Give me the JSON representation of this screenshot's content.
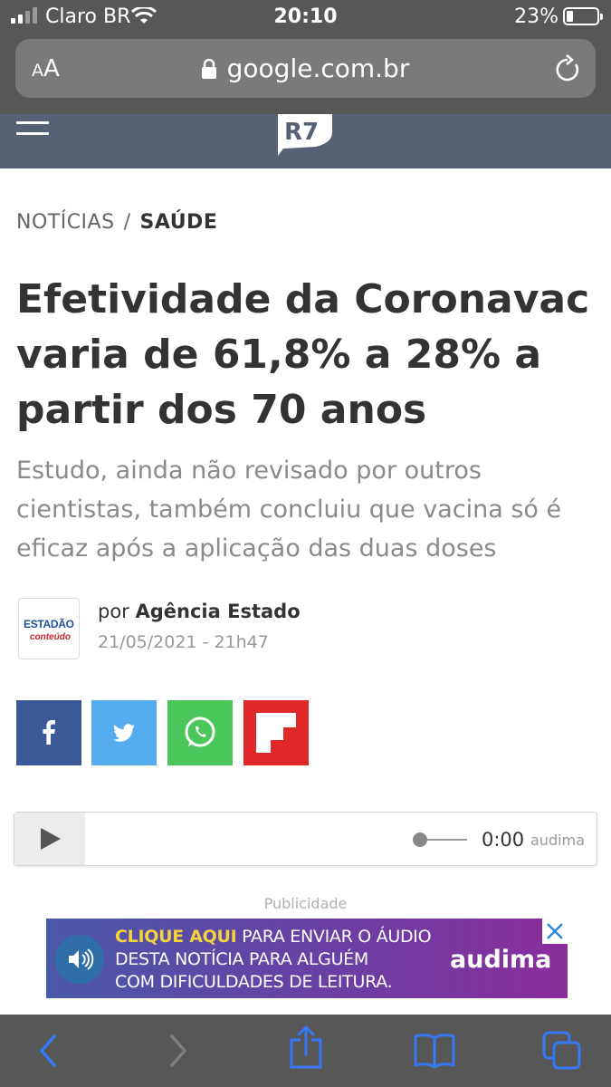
{
  "status_bar": {
    "carrier": "Claro BR",
    "time": "20:10",
    "battery_percent": "23%"
  },
  "browser": {
    "text_size_button": "AA",
    "url": "google.com.br"
  },
  "site": {
    "logo_text": "R7"
  },
  "article": {
    "breadcrumb": [
      "NOTÍCIAS",
      "SAÚDE"
    ],
    "breadcrumb_separator": "/",
    "headline": "Efetividade da Coronavac varia de 61,8% a 28% a partir dos 70 anos",
    "subtitle": "Estudo, ainda não revisado por outros cientistas, também concluiu que vacina só é eficaz após a aplicação das duas doses",
    "author_logo": {
      "line1": "ESTADÃO",
      "line2": "conteúdo"
    },
    "byline_prefix": "por",
    "author": "Agência Estado",
    "date": "21/05/2021 - 21h47"
  },
  "share_buttons": [
    "facebook-icon",
    "twitter-icon",
    "whatsapp-icon",
    "flipboard-icon"
  ],
  "audio_player": {
    "time": "0:00",
    "brand": "audima",
    "progress": 0
  },
  "ad": {
    "label": "Publicidade",
    "highlight": "CLIQUE AQUI",
    "line1_rest": " PARA ENVIAR O ÁUDIO",
    "line2": "DESTA NOTÍCIA PARA ALGUÉM",
    "line3": "COM DIFICULDADES DE LEITURA.",
    "brand": "audima"
  },
  "colors": {
    "site_header": "#566176",
    "facebook": "#3b5998",
    "twitter": "#55acee",
    "whatsapp": "#4bc65a",
    "flipboard": "#e12828",
    "ios_tint": "#3478f6"
  }
}
